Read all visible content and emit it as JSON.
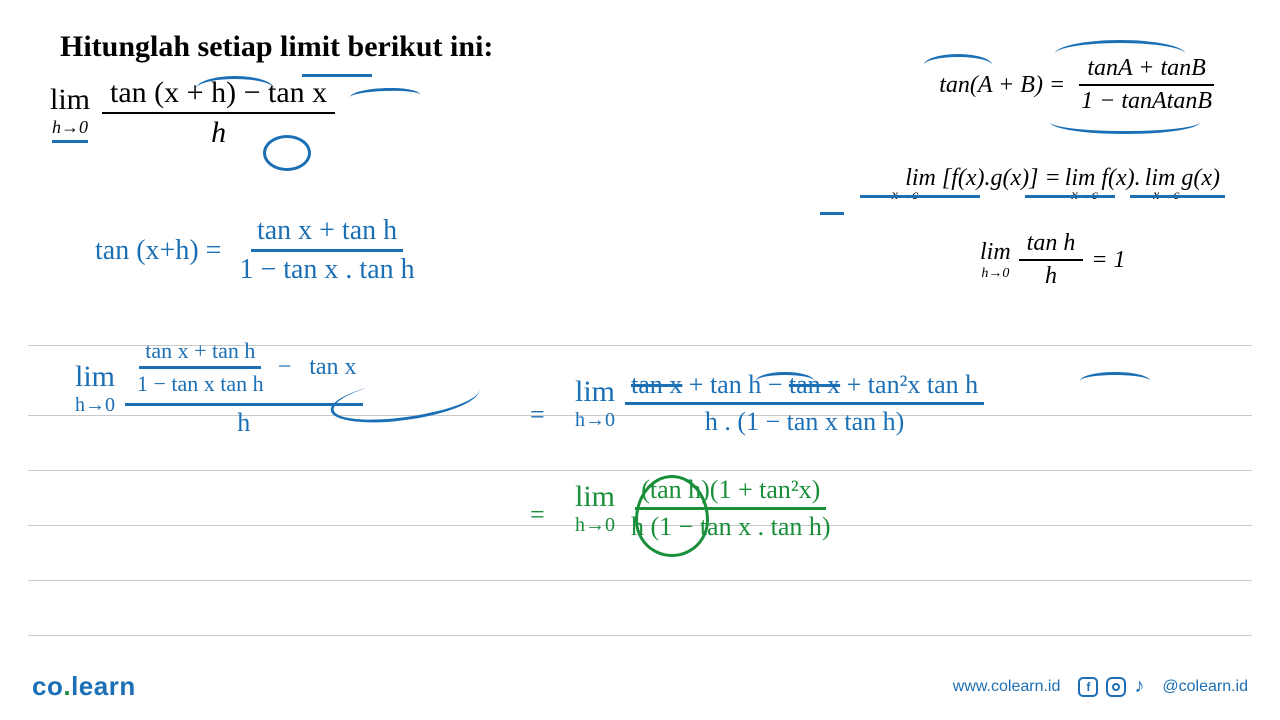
{
  "title": "Hitunglah setiap limit berikut ini:",
  "problem": {
    "lim": "lim",
    "approach": "h→0",
    "numerator": "tan (x + h)  −  tan x",
    "denominator": "h"
  },
  "formulas": {
    "tan_sum_lhs": "tan(A + B) =",
    "tan_sum_num": "tanA + tanB",
    "tan_sum_den": "1 − tanAtanB",
    "product_lhs": "lim [f(x).g(x)] =",
    "product_sub1": "x→c",
    "product_rhs1": "lim f(x).",
    "product_sub2": "x→c",
    "product_rhs2": "lim g(x)",
    "product_sub3": "x→c",
    "tanh_lim": "lim",
    "tanh_sub": "h→0",
    "tanh_num": "tan h",
    "tanh_den": "h",
    "tanh_eq": "= 1"
  },
  "work": {
    "step1_lhs": "tan (x+h) =",
    "step1_num": "tan x + tan h",
    "step1_den": "1 − tan x . tan h",
    "step2_lim": "lim",
    "step2_sub": "h→0",
    "step2_inner_num": "tan x + tan h",
    "step2_inner_den": "1 − tan x  tan h",
    "step2_minus": "−   tan x",
    "step2_outer_den": "h",
    "equals": "=",
    "step3_lim": "lim",
    "step3_sub": "h→0",
    "step3_num_a": "tan x",
    "step3_num_b": "+ tan h −",
    "step3_num_c": "tan x",
    "step3_num_d": "+ tan²x tan h",
    "step3_den": "h . (1 − tan x  tan h)",
    "step4_eq": "=",
    "step4_lim": "lim",
    "step4_sub": "h→0",
    "step4_num": "(tan h)(1 + tan²x)",
    "step4_den_a": "h",
    "step4_den_b": "(1 − tan x . tan h)"
  },
  "footer": {
    "brand_a": "co",
    "brand_b": "learn",
    "url": "www.colearn.id",
    "handle": "@colearn.id"
  }
}
